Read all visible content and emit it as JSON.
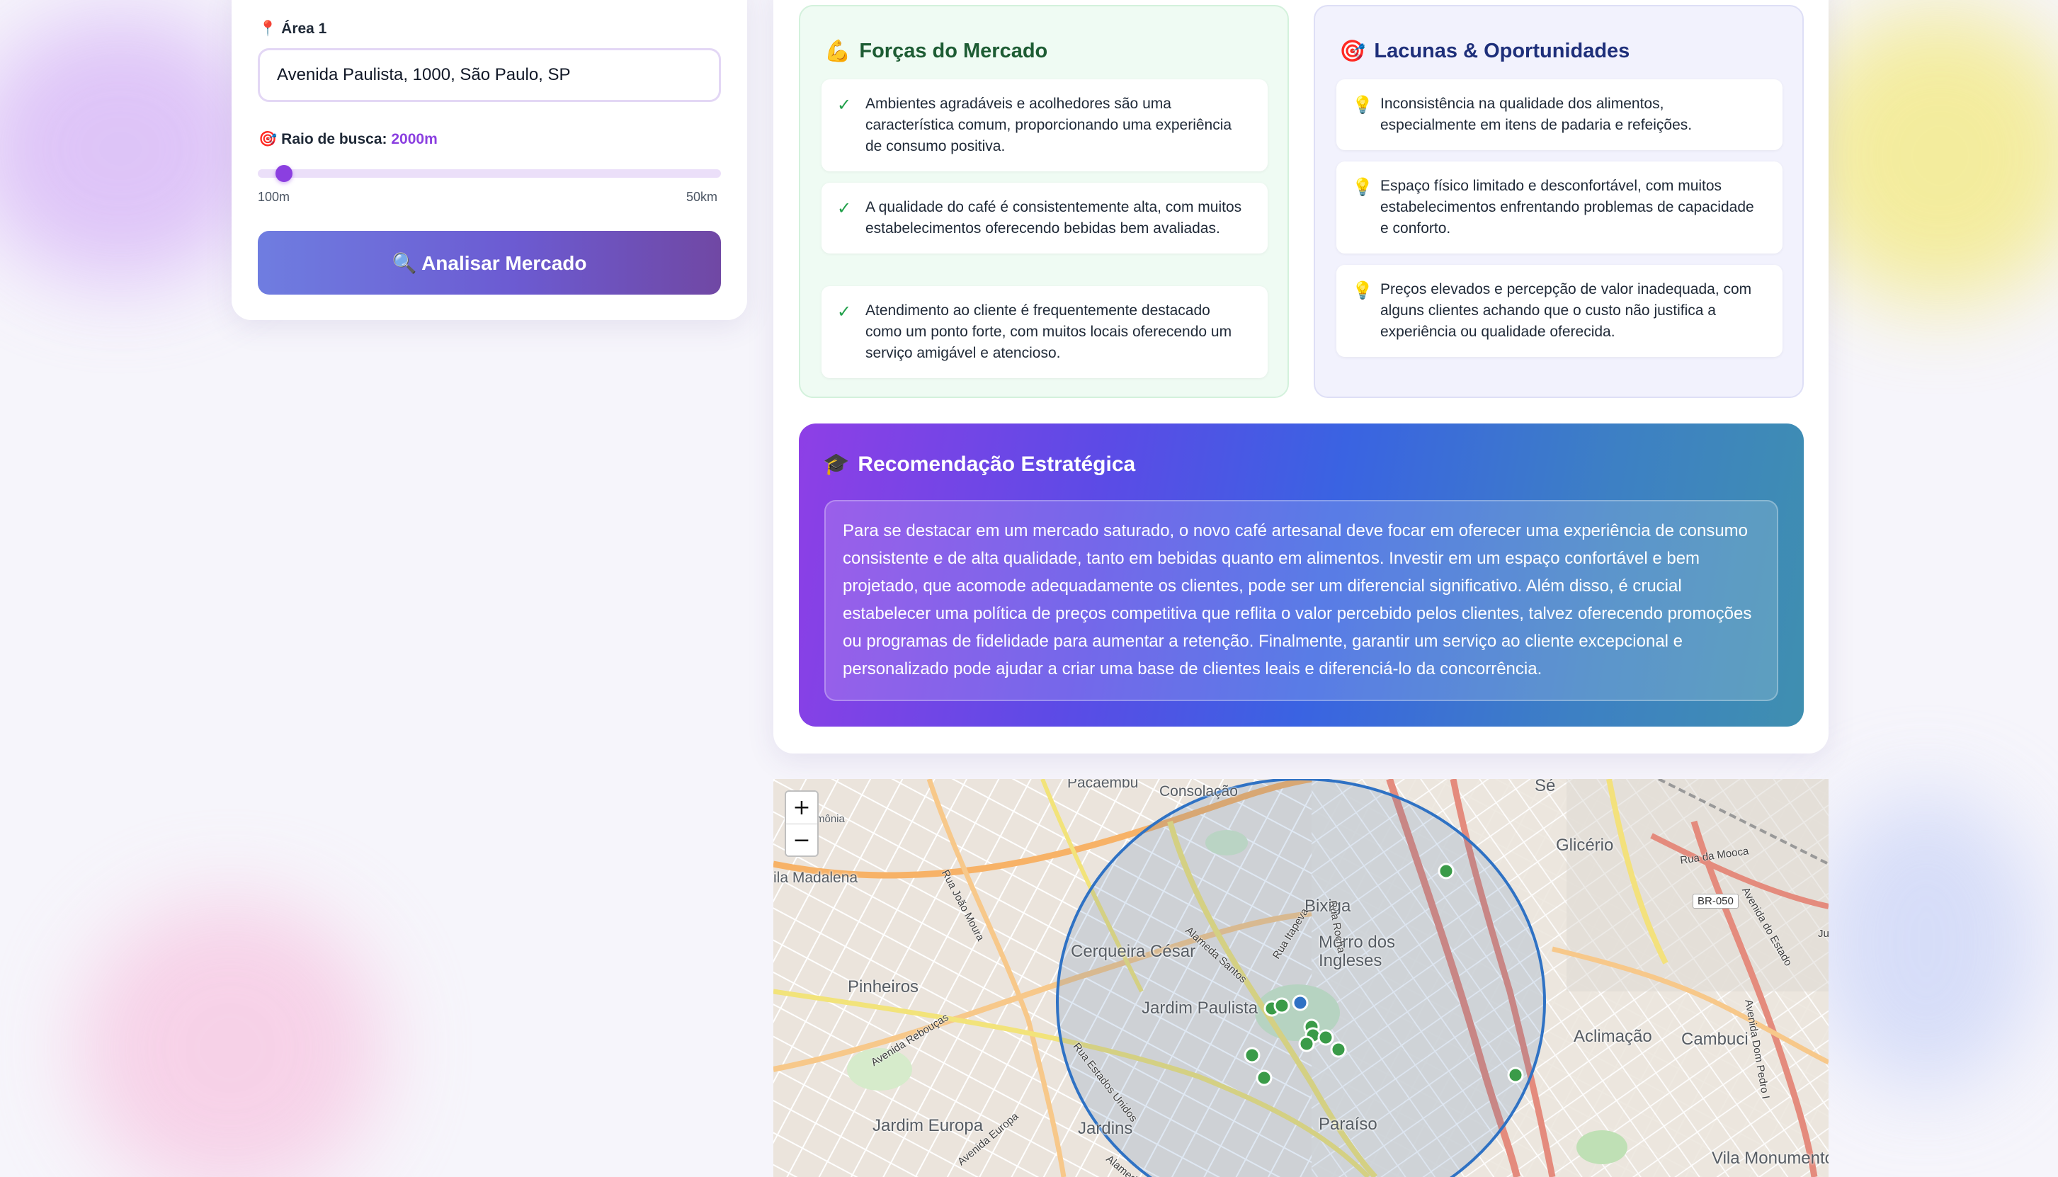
{
  "form": {
    "area_label": "Área 1",
    "area_icon": "📍",
    "address_value": "Avenida Paulista, 1000, São Paulo, SP",
    "radius_icon": "🎯",
    "radius_label": "Raio de busca:",
    "radius_value": "2000m",
    "slider_min": "100m",
    "slider_max": "50km",
    "slider_fraction": 0.038,
    "analyze_button": "🔍 Analisar Mercado"
  },
  "strengths": {
    "icon": "💪",
    "title": "Forças do Mercado",
    "check_icon": "✓",
    "items": [
      "Ambientes agradáveis e acolhedores são uma característica comum, proporcionando uma experiência de consumo positiva.",
      "A qualidade do café é consistentemente alta, com muitos estabelecimentos oferecendo bebidas bem avaliadas.",
      "Atendimento ao cliente é frequentemente destacado como um ponto forte, com muitos locais oferecendo um serviço amigável e atencioso."
    ]
  },
  "gaps": {
    "icon": "🎯",
    "title": "Lacunas & Oportunidades",
    "bulb_icon": "💡",
    "items": [
      "Inconsistência na qualidade dos alimentos, especialmente em itens de padaria e refeições.",
      "Espaço físico limitado e desconfortável, com muitos estabelecimentos enfrentando problemas de capacidade e conforto.",
      "Preços elevados e percepção de valor inadequada, com alguns clientes achando que o custo não justifica a experiência ou qualidade oferecida."
    ]
  },
  "recommendation": {
    "icon": "🎓",
    "title": "Recomendação Estratégica",
    "text": "Para se destacar em um mercado saturado, o novo café artesanal deve focar em oferecer uma experiência de consumo consistente e de alta qualidade, tanto em bebidas quanto em alimentos. Investir em um espaço confortável e bem projetado, que acomode adequadamente os clientes, pode ser um diferencial significativo. Além disso, é crucial estabelecer uma política de preços competitiva que reflita o valor percebido pelos clientes, talvez oferecendo promoções ou programas de fidelidade para aumentar a retenção. Finalmente, garantir um serviço ao cliente excepcional e personalizado pode ajudar a criar uma base de clientes leais e diferenciá-lo da concorrência."
  },
  "map": {
    "zoom_in": "+",
    "zoom_out": "−",
    "labels": {
      "pacaembu": "Pacaembu",
      "consolacao": "Consolação",
      "vila_madalena": "ila Madalena",
      "pinheiros": "Pinheiros",
      "cerqueira_cesar": "Cerqueira César",
      "jardim_paulista": "Jardim Paulista",
      "jardim_europa": "Jardim Europa",
      "jardins": "Jardins",
      "paraiso": "Paraíso",
      "bixiga": "Bixiga",
      "morro_dos_ingleses": "Morro dos Ingleses",
      "se": "Sé",
      "glicerio": "Glicério",
      "aclimacao": "Aclimação",
      "cambuci": "Cambuci",
      "vila_monumento": "Vila Monumento",
      "monia": "mônia"
    },
    "roads": {
      "joao_moura": "Rua João Moura",
      "rebouças": "Avenida Rebouças",
      "estados_unidos": "Rua Estados Unidos",
      "europa": "Avenida Europa",
      "santos": "Alameda Santos",
      "itapeva": "Rua Itapeva",
      "rocha": "Rua Rocha",
      "mooca": "Rua da Mooca",
      "estado": "Avenida do Estado",
      "dom_pedro": "Avenida Dom Pedro I",
      "br050": "BR-050",
      "hidden_ave": "Alameda",
      "jun": "Jun"
    }
  }
}
